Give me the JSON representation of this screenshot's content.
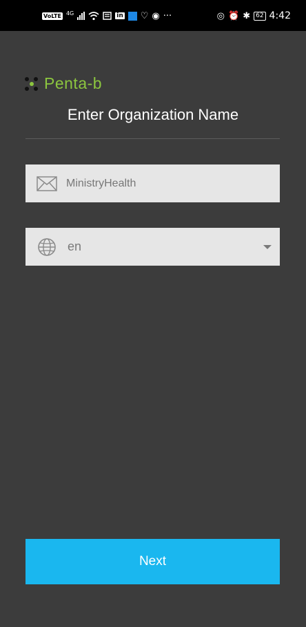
{
  "status_bar": {
    "volte": "VoLTE",
    "network": "4G",
    "battery": "62",
    "time": "4:42",
    "more": "···"
  },
  "logo": {
    "text": "Penta-b"
  },
  "title": "Enter Organization Name",
  "org_field": {
    "value": "MinistryHealth",
    "placeholder": ""
  },
  "language_select": {
    "value": "en"
  },
  "next_button": {
    "label": "Next"
  },
  "colors": {
    "background": "#3c3c3c",
    "accent": "#1ab7ef",
    "logo_green": "#8cc63f",
    "field_bg": "#e6e6e6"
  }
}
